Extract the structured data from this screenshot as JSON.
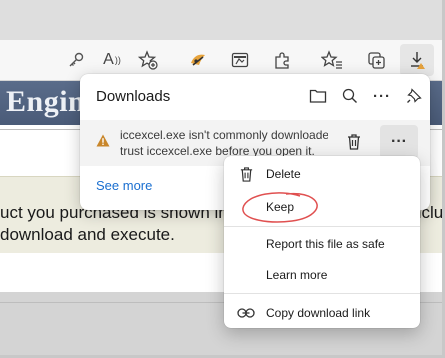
{
  "toolbar": {
    "icons": [
      "key-icon",
      "read-aloud-icon",
      "add-favorite-icon",
      "extension-icon",
      "web-capture-icon",
      "extensions-icon",
      "favorites-icon",
      "collections-icon",
      "downloads-icon"
    ],
    "read_aloud_glyph": "A"
  },
  "page": {
    "banner_text": "Engine",
    "line1": "uct you purchased is shown in",
    "line1_tail": "nclu",
    "line2": "download and execute."
  },
  "downloads": {
    "title": "Downloads",
    "item": {
      "line1": "iccexcel.exe isn't commonly downloade",
      "line2": "trust iccexcel.exe before you open it.",
      "more_label": "···"
    },
    "see_more": "See more"
  },
  "menu": {
    "items": [
      {
        "label": "Delete",
        "icon": "trash-icon"
      },
      {
        "label": "Keep",
        "icon": ""
      },
      {
        "label": "Report this file as safe",
        "icon": ""
      },
      {
        "label": "Learn more",
        "icon": ""
      },
      {
        "label": "Copy download link",
        "icon": "link-icon"
      }
    ]
  },
  "colors": {
    "accent": "#1a6fd0",
    "warning": "#c8862a",
    "annotation": "#e05050"
  }
}
